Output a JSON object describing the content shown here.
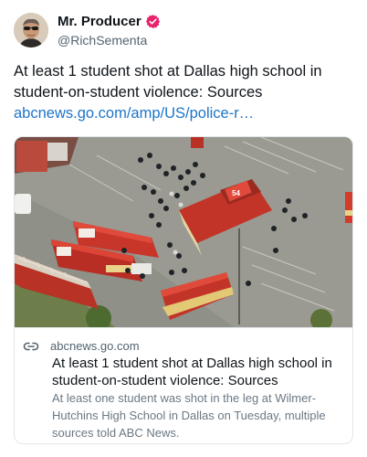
{
  "author": {
    "name": "Mr. Producer",
    "handle": "@RichSementa",
    "verified": true
  },
  "post": {
    "text": "At least 1 student shot at Dallas high school in student-on-student violence: Sources",
    "link_text": "abcnews.go.com/amp/US/police-r…"
  },
  "card": {
    "domain": "abcnews.go.com",
    "title": "At least 1 student shot at Dallas high school in student-on-student violence: Sources",
    "description": "At least one student was shot in the leg at Wilmer-Hutchins High School in Dallas on Tuesday, multiple sources told ABC News.",
    "image_icon": "aerial-photo-fire-trucks-parking-lot",
    "truck_number": "54"
  },
  "colors": {
    "link": "#1d74c9",
    "verified_badge": "#e8236b",
    "secondary_text": "#536471"
  }
}
